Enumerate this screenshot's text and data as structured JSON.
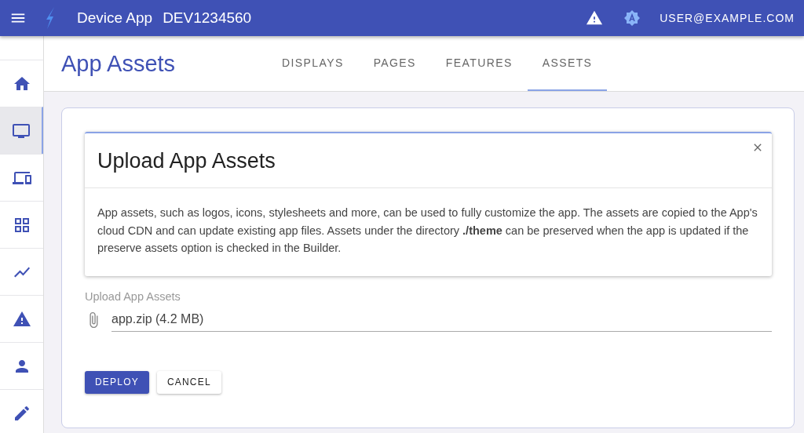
{
  "topbar": {
    "app_name": "Device App",
    "device_id": "DEV1234560",
    "user": "USER@EXAMPLE.COM"
  },
  "sidebar": {
    "items": [
      {
        "kind": "home",
        "selected": false
      },
      {
        "kind": "display",
        "selected": true
      },
      {
        "kind": "devices",
        "selected": false
      },
      {
        "kind": "grid",
        "selected": false
      },
      {
        "kind": "chart",
        "selected": false
      },
      {
        "kind": "warning",
        "selected": false
      },
      {
        "kind": "person",
        "selected": false
      },
      {
        "kind": "edit",
        "selected": false
      }
    ]
  },
  "page": {
    "title": "App Assets"
  },
  "tabs": [
    {
      "label": "DISPLAYS",
      "selected": false
    },
    {
      "label": "PAGES",
      "selected": false
    },
    {
      "label": "FEATURES",
      "selected": false
    },
    {
      "label": "ASSETS",
      "selected": true
    }
  ],
  "dialog": {
    "title": "Upload App Assets",
    "body": "App assets, such as logos, icons, stylesheets and more, can be used to fully customize the app. The assets are copied to the App's cloud CDN and can update existing app files. Assets under the directory **./theme** can be preserved when the app is updated if the preserve assets option is checked in the Builder."
  },
  "upload": {
    "label": "Upload App Assets",
    "value": "app.zip (4.2 MB)"
  },
  "buttons": [
    {
      "label": "DEPLOY",
      "kind": "primary"
    },
    {
      "label": "CANCEL",
      "kind": "secondary"
    }
  ]
}
